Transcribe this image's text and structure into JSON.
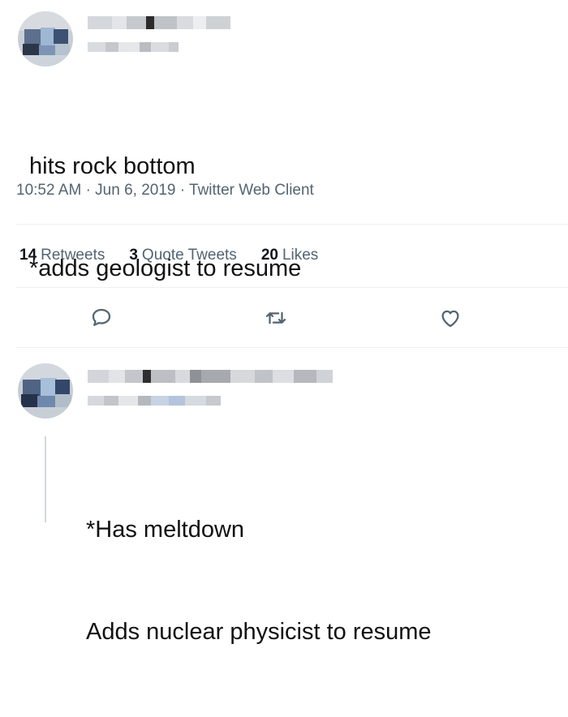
{
  "tweet": {
    "lines": [
      "hits rock bottom",
      "*adds geologist to resume"
    ],
    "time": "10:52 AM",
    "date": "Jun 6, 2019",
    "client": "Twitter Web Client",
    "separator": "·",
    "stats": [
      {
        "count": "14",
        "label": "Retweets"
      },
      {
        "count": "3",
        "label": "Quote Tweets"
      },
      {
        "count": "20",
        "label": "Likes"
      }
    ],
    "actions": [
      "reply-icon",
      "retweet-icon",
      "like-icon"
    ]
  },
  "reply": {
    "lines": [
      "*Has meltdown",
      "Adds nuclear physicist to resume"
    ]
  },
  "colors": {
    "muted": "#536471",
    "divider": "#eef0f2",
    "icon": "#536471"
  }
}
